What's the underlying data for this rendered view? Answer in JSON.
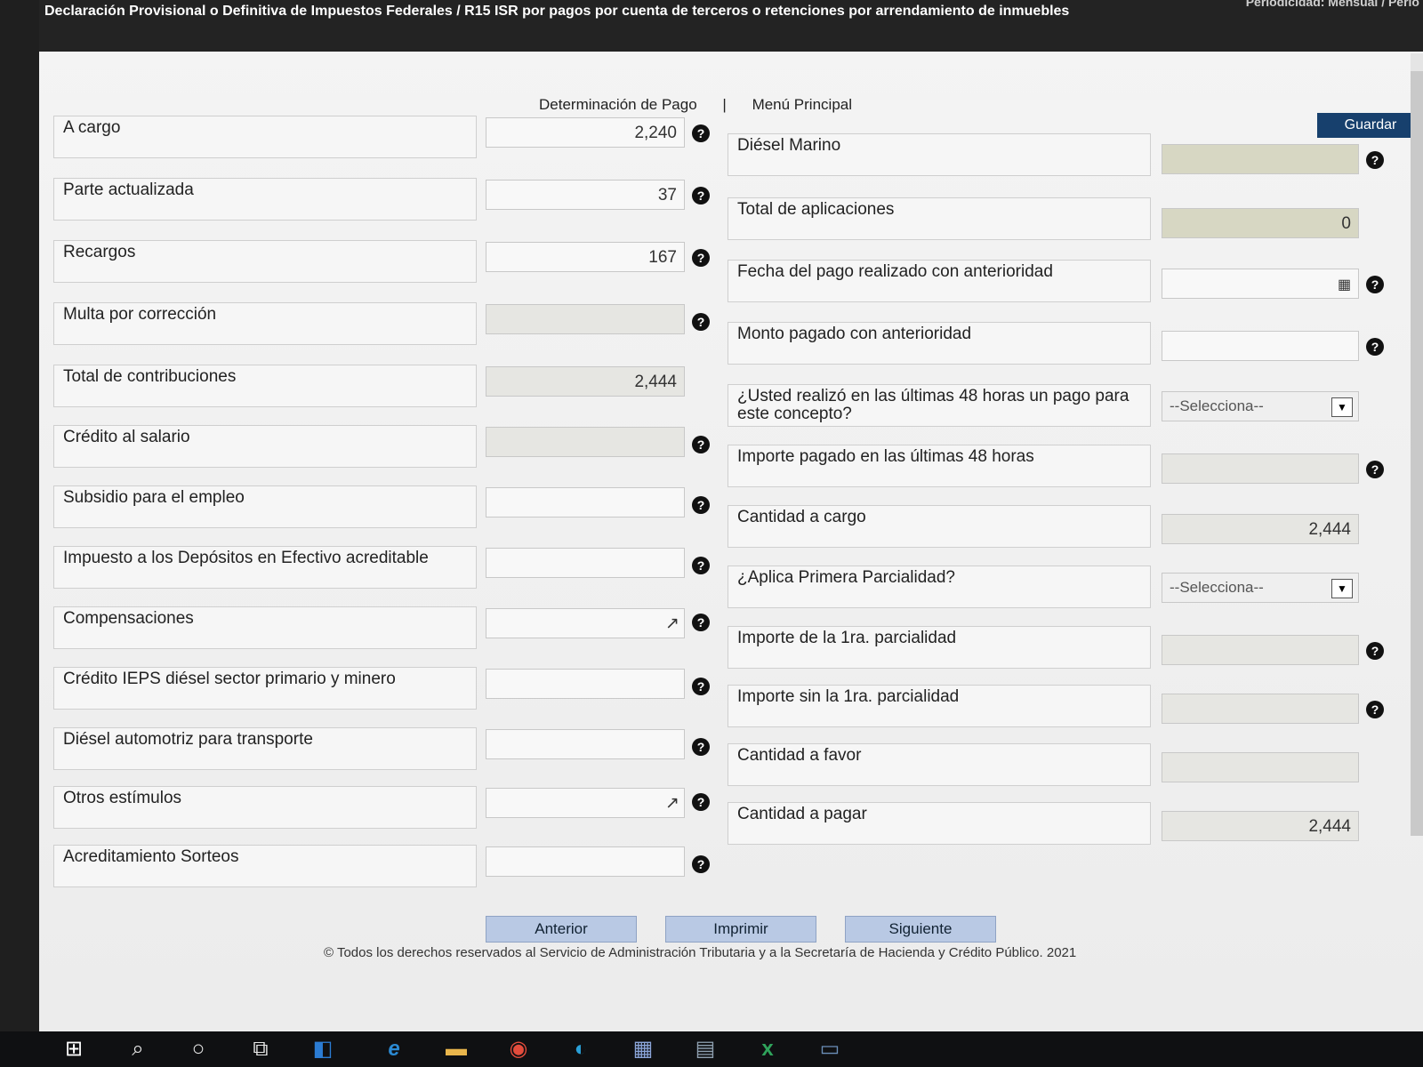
{
  "window": {
    "title": "Declaración Provisional o Definitiva de Impuestos Federales / R15 ISR por pagos por cuenta de terceros o retenciones por arrendamiento de inmuebles",
    "period": "Periodicidad: Mensual / Perio"
  },
  "nav": {
    "determinacion": "Determinación de Pago",
    "separator": "|",
    "menu": "Menú Principal"
  },
  "guardar_label": "Guardar",
  "help_glyph": "?",
  "left": [
    {
      "label": "A cargo",
      "value": "2,240"
    },
    {
      "label": "Parte actualizada",
      "value": "37"
    },
    {
      "label": "Recargos",
      "value": "167"
    },
    {
      "label": "Multa por corrección",
      "value": ""
    },
    {
      "label": "Total de contribuciones",
      "value": "2,444"
    },
    {
      "label": "Crédito al salario",
      "value": ""
    },
    {
      "label": "Subsidio para el empleo",
      "value": ""
    },
    {
      "label": "Impuesto a los Depósitos en Efectivo acreditable",
      "value": ""
    },
    {
      "label": "Compensaciones",
      "value": ""
    },
    {
      "label": "Crédito IEPS diésel sector primario y minero",
      "value": ""
    },
    {
      "label": "Diésel automotriz para transporte",
      "value": ""
    },
    {
      "label": "Otros estímulos",
      "value": ""
    },
    {
      "label": "Acreditamiento Sorteos",
      "value": ""
    }
  ],
  "right": [
    {
      "label": "Diésel Marino",
      "value": ""
    },
    {
      "label": "Total de aplicaciones",
      "value": "0"
    },
    {
      "label": "Fecha del pago realizado con anterioridad",
      "value": ""
    },
    {
      "label": "Monto pagado con anterioridad",
      "value": ""
    },
    {
      "label": "¿Usted realizó en las últimas 48 horas un pago para este concepto?",
      "value": "--Selecciona--"
    },
    {
      "label": "Importe pagado en las últimas 48 horas",
      "value": ""
    },
    {
      "label": "Cantidad a cargo",
      "value": "2,444"
    },
    {
      "label": "¿Aplica Primera Parcialidad?",
      "value": "--Selecciona--"
    },
    {
      "label": "Importe de la 1ra. parcialidad",
      "value": ""
    },
    {
      "label": "Importe sin la 1ra. parcialidad",
      "value": ""
    },
    {
      "label": "Cantidad a favor",
      "value": ""
    },
    {
      "label": "Cantidad a pagar",
      "value": "2,444"
    }
  ],
  "buttons": {
    "anterior": "Anterior",
    "imprimir": "Imprimir",
    "siguiente": "Siguiente"
  },
  "footer": "© Todos los derechos reservados al Servicio de Administración Tributaria y a la Secretaría de Hacienda y Crédito Público. 2021",
  "taskbar": [
    "windows-start",
    "search",
    "cortana",
    "task-view",
    "outlook",
    "edge-legacy",
    "file-explorer",
    "chrome",
    "edge",
    "store",
    "calculator",
    "excel",
    "app"
  ]
}
